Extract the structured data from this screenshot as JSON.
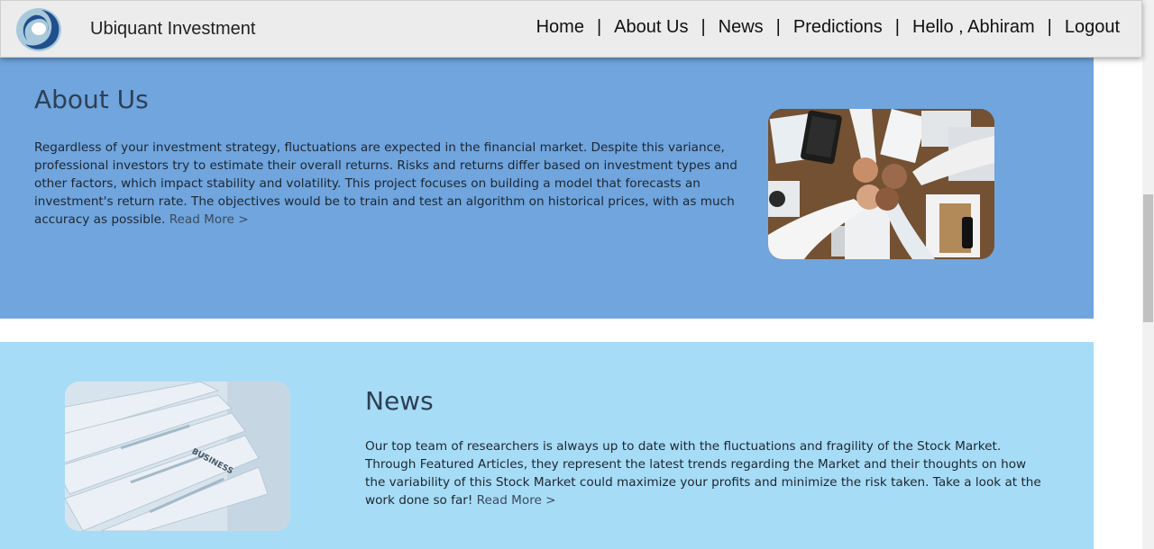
{
  "header": {
    "brand": "Ubiquant Investment",
    "logo_icon": "ubiquant-swirl-logo",
    "nav": {
      "home": "Home",
      "about": "About Us",
      "news": "News",
      "predictions": "Predictions",
      "greeting": "Hello , Abhiram",
      "logout": "Logout",
      "separator": "|"
    }
  },
  "about": {
    "title": "About Us",
    "body": "Regardless of your investment strategy, fluctuations are expected in the financial market. Despite this variance, professional investors try to estimate their overall returns. Risks and returns differ based on investment types and other factors, which impact stability and volatility. This project focuses on building a model that forecasts an investment's return rate. The objectives would be to train and test an algorithm on historical prices, with as much accuracy as possible.",
    "read_more": "Read More >",
    "image": "team-fist-bump-photo"
  },
  "news": {
    "title": "News",
    "body": "Our top team of researchers is always up to date with the fluctuations and fragility of the Stock Market. Through Featured Articles, they represent the latest trends regarding the Market and their thoughts on how the variability of this Stock Market could maximize your profits and minimize the risk taken. Take a look at the work done so far!",
    "read_more": "Read More >",
    "image": "newspapers-photo",
    "image_text": "BUSINESS"
  },
  "colors": {
    "navbar_bg": "#ececec",
    "about_bg": "#70a5de",
    "news_bg": "#a7dcf6",
    "heading": "#2d4055"
  }
}
